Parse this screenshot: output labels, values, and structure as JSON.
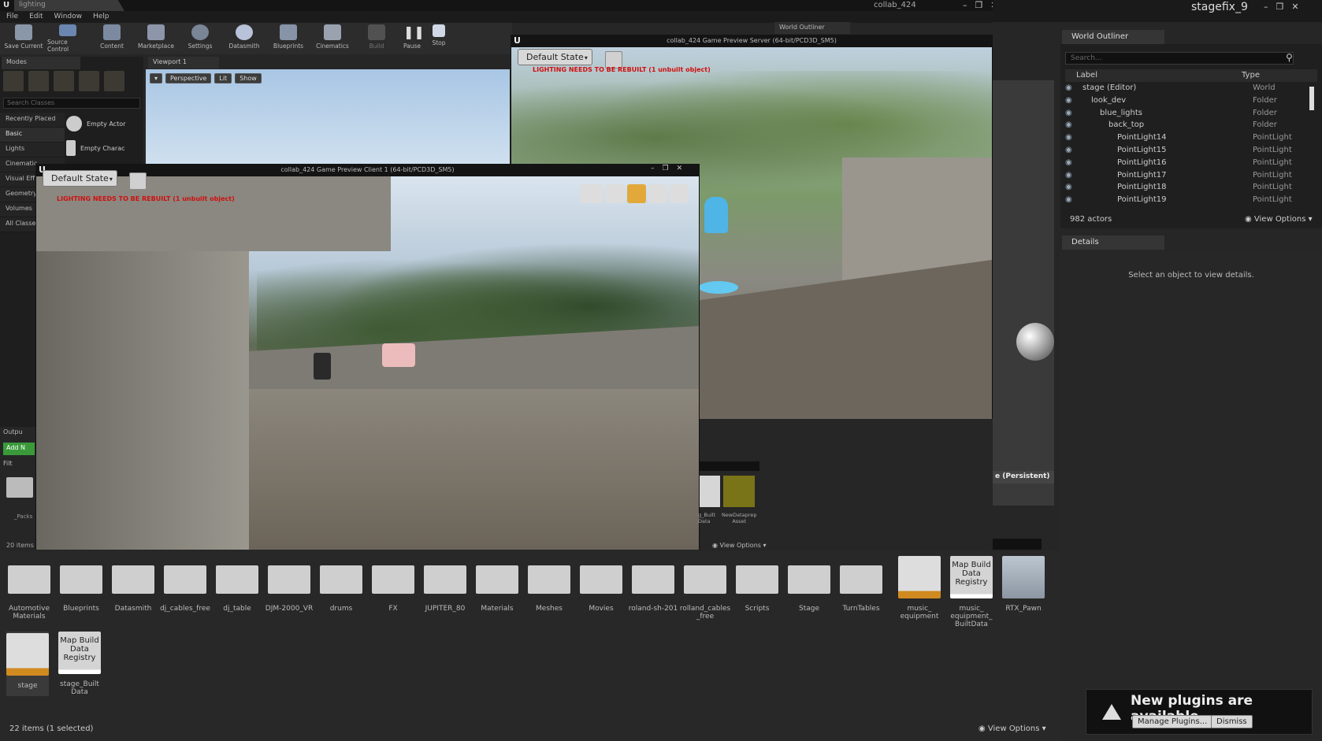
{
  "app": {
    "level_tab": "lighting",
    "server_window_tab": "collab_424",
    "right_window_title": "stagefix_9",
    "menu": [
      "File",
      "Edit",
      "Window",
      "Help"
    ]
  },
  "toolbar": [
    {
      "label": "Save Current",
      "icon": "save-icon"
    },
    {
      "label": "Source Control",
      "icon": "source-control-icon"
    },
    {
      "label": "Content",
      "icon": "content-icon"
    },
    {
      "label": "Marketplace",
      "icon": "marketplace-icon"
    },
    {
      "label": "Settings",
      "icon": "gear-icon"
    },
    {
      "label": "Datasmith",
      "icon": "datasmith-icon"
    },
    {
      "label": "Blueprints",
      "icon": "blueprint-icon"
    },
    {
      "label": "Cinematics",
      "icon": "clapper-icon"
    },
    {
      "label": "Build",
      "icon": "build-icon"
    },
    {
      "label": "Pause",
      "icon": "pause-icon"
    },
    {
      "label": "Stop",
      "icon": "stop-icon"
    }
  ],
  "modes": {
    "tab": "Modes",
    "search_placeholder": "Search Classes",
    "categories": [
      "Recently Placed",
      "Basic",
      "Lights",
      "Cinematic",
      "Visual Eff",
      "Geometry",
      "Volumes",
      "All Classe"
    ],
    "items": [
      "Empty Actor",
      "Empty Charac"
    ]
  },
  "viewport1": {
    "tab": "Viewport 1",
    "buttons": [
      "Perspective",
      "Lit",
      "Show"
    ]
  },
  "server": {
    "title": "collab_424 Game Preview Server (64-bit/PCD3D_SM5)",
    "default_state": "Default State",
    "warning": "LIGHTING NEEDS TO BE REBUILT (1 unbuilt object)"
  },
  "client": {
    "title": "collab_424 Game Preview Client 1 (64-bit/PCD3D_SM5)",
    "default_state": "Default State",
    "warning": "LIGHTING NEEDS TO BE REBUILT (1 unbuilt object)"
  },
  "world_outliner_bg_tab": "World Outliner",
  "outliner": {
    "tab": "World Outliner",
    "search_placeholder": "Search...",
    "col_label": "Label",
    "col_type": "Type",
    "rows": [
      {
        "label": "stage (Editor)",
        "type": "World",
        "indent": 0
      },
      {
        "label": "look_dev",
        "type": "Folder",
        "indent": 1
      },
      {
        "label": "blue_lights",
        "type": "Folder",
        "indent": 2
      },
      {
        "label": "back_top",
        "type": "Folder",
        "indent": 3
      },
      {
        "label": "PointLight14",
        "type": "PointLight",
        "indent": 4
      },
      {
        "label": "PointLight15",
        "type": "PointLight",
        "indent": 4
      },
      {
        "label": "PointLight16",
        "type": "PointLight",
        "indent": 4
      },
      {
        "label": "PointLight17",
        "type": "PointLight",
        "indent": 4
      },
      {
        "label": "PointLight18",
        "type": "PointLight",
        "indent": 4
      },
      {
        "label": "PointLight19",
        "type": "PointLight",
        "indent": 4
      }
    ],
    "actor_count": "982 actors",
    "view_options": "View Options"
  },
  "details": {
    "tab": "Details",
    "empty_text": "Select an object to view details."
  },
  "persistent_label": "e (Persistent)",
  "left_lower": {
    "output_tab": "Outpu",
    "add_button": "Add N",
    "filter": "Filt",
    "packs": "_Packs",
    "count": "20 items"
  },
  "mid_content": {
    "items": [
      "g_Built\nData",
      "NewDataprep\nAsset"
    ],
    "view_options": "View Options"
  },
  "content_browser": {
    "folders": [
      "Automotive\nMaterials",
      "Blueprints",
      "Datasmith",
      "dj_cables_free",
      "dj_table",
      "DJM-2000_VR",
      "drums",
      "FX",
      "JUPITER_80",
      "Materials",
      "Meshes",
      "Movies",
      "roland-sh-201",
      "rolland_cables\n_free",
      "Scripts",
      "Stage",
      "TurnTables"
    ],
    "assets_row1": [
      {
        "label": "music_\nequipment",
        "kind": "map"
      },
      {
        "label": "music_\nequipment_\nBuiltData",
        "kind": "registry",
        "thumb_text": "Map Build\nData\nRegistry"
      },
      {
        "label": "RTX_Pawn",
        "kind": "pawn"
      }
    ],
    "assets_row2": [
      {
        "label": "stage",
        "kind": "map"
      },
      {
        "label": "stage_Built\nData",
        "kind": "registry",
        "thumb_text": "Map Build\nData\nRegistry"
      }
    ],
    "status": "22 items (1 selected)",
    "view_options": "View Options"
  },
  "notification": {
    "text": "New plugins are available",
    "manage": "Manage Plugins...",
    "dismiss": "Dismiss"
  }
}
